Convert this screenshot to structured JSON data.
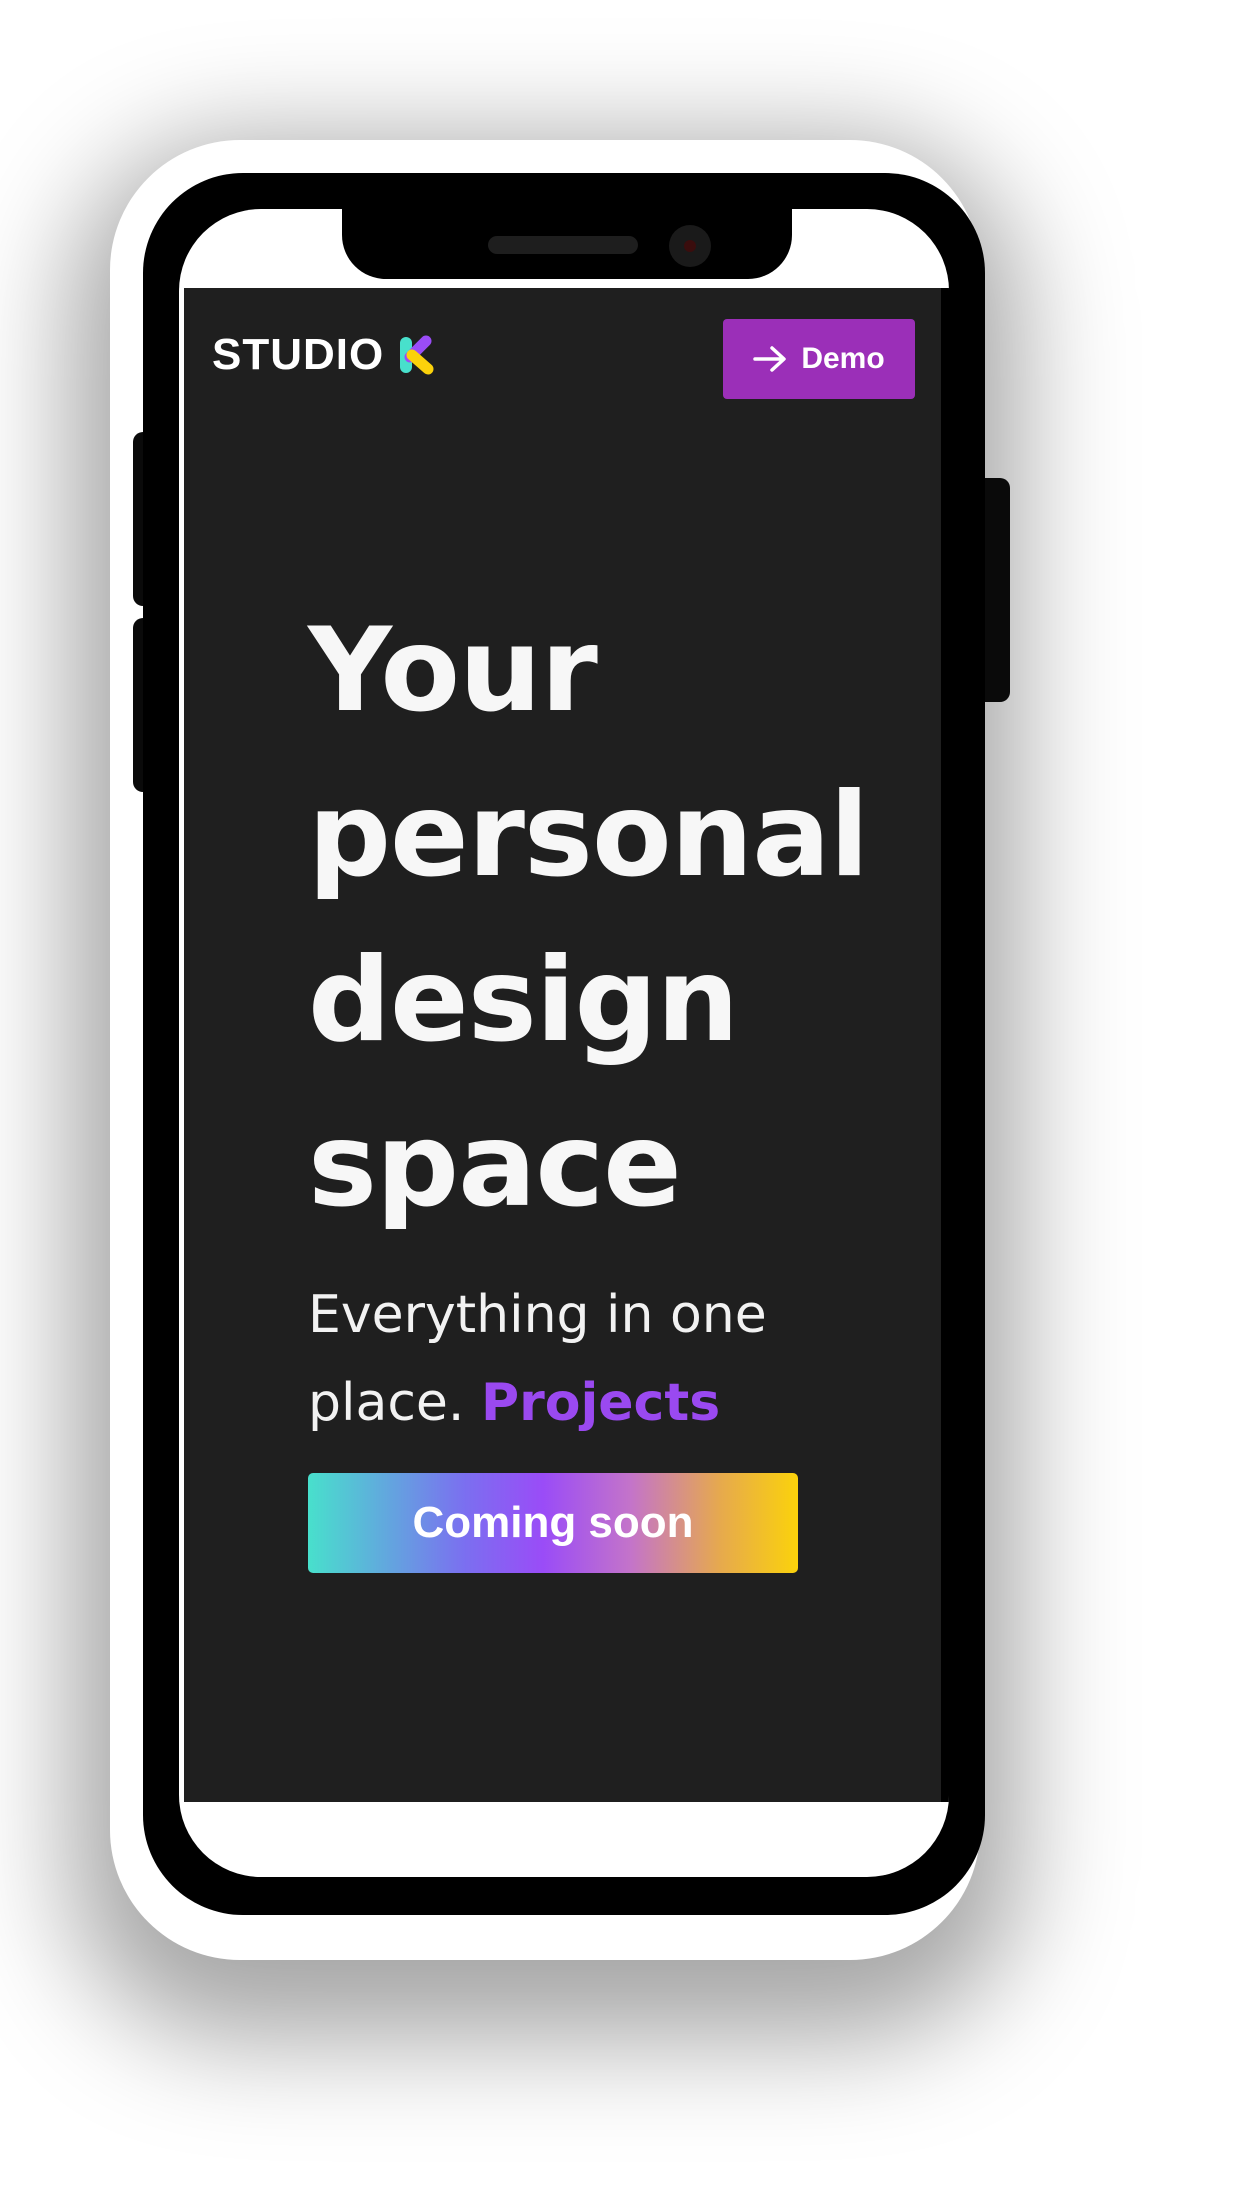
{
  "header": {
    "logo_text": "STUDIO",
    "demo_label": "Demo"
  },
  "hero": {
    "headline_lines": [
      "Your",
      "personal",
      "design",
      "space"
    ],
    "subtitle": "Everything in one place.",
    "rotating_word": "Projects",
    "cta_label": "Coming soon"
  },
  "colors": {
    "app_background": "#1f1f1f",
    "demo_button": "#9b2fb8",
    "accent_text": "#9a49f0",
    "cta_gradient": [
      "#48e0cc",
      "#9a4cf7",
      "#fbd20b"
    ],
    "logo_mark": [
      "#48e0cc",
      "#9a4cf7",
      "#fbd20b"
    ]
  },
  "icons": {
    "demo_button_icon": "arrow-right-icon",
    "logo_mark": "k-logo-icon"
  }
}
